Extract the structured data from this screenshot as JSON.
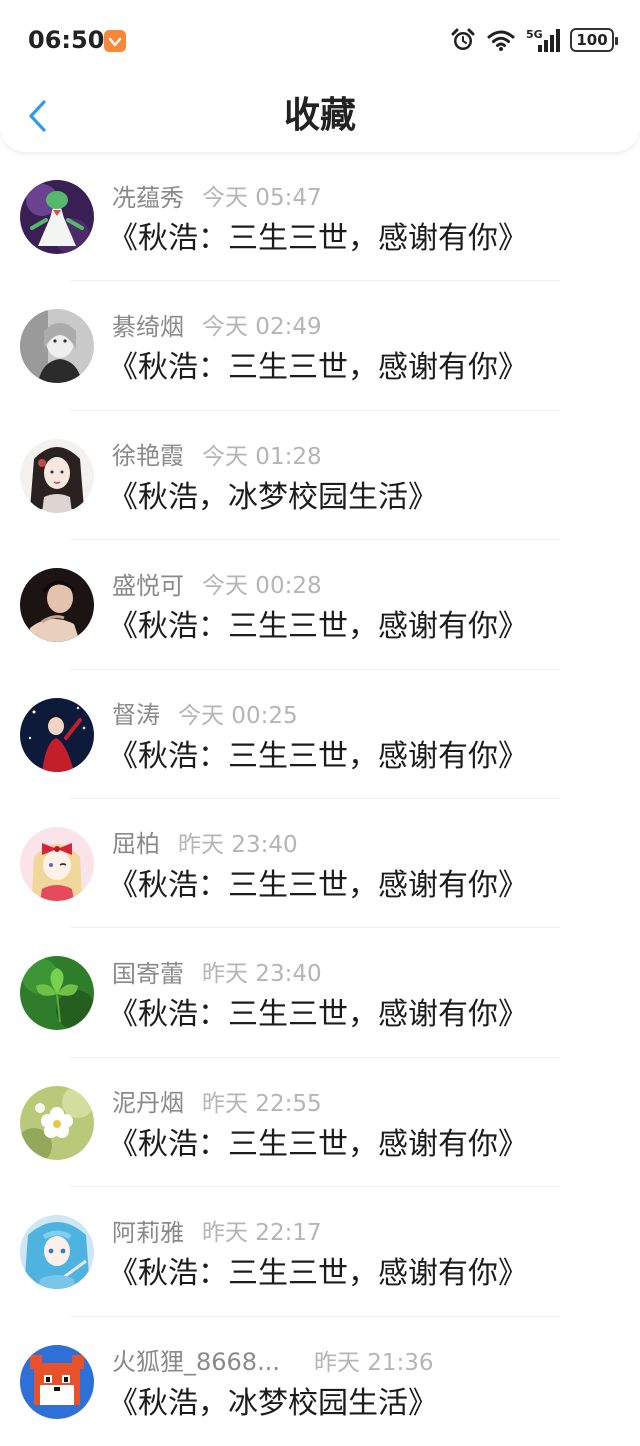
{
  "status_bar": {
    "time": "06:50",
    "network": "5G",
    "battery": "100",
    "app_badge_color": "#f5893a"
  },
  "nav": {
    "back_icon": "chevron-left-icon",
    "title": "收藏",
    "accent": "#2f9bf0"
  },
  "items": [
    {
      "name": "冼蕴秀",
      "time": "今天 05:47",
      "title": "《秋浩：三生三世，感谢有你》",
      "avatar": "pokemon-gardevoir"
    },
    {
      "name": "綦绮烟",
      "time": "今天 02:49",
      "title": "《秋浩：三生三世，感谢有你》",
      "avatar": "bw-girl-portrait"
    },
    {
      "name": "徐艳霞",
      "time": "今天 01:28",
      "title": "《秋浩，冰梦校园生活》",
      "avatar": "ink-girl"
    },
    {
      "name": "盛悦可",
      "time": "今天 00:28",
      "title": "《秋浩：三生三世，感谢有你》",
      "avatar": "dark-portrait"
    },
    {
      "name": "督涛",
      "time": "今天 00:25",
      "title": "《秋浩：三生三世，感谢有你》",
      "avatar": "red-dress-girl"
    },
    {
      "name": "屈柏",
      "time": "昨天 23:40",
      "title": "《秋浩：三生三世，感谢有你》",
      "avatar": "anime-bow-girl"
    },
    {
      "name": "国寄蕾",
      "time": "昨天 23:40",
      "title": "《秋浩：三生三世，感谢有你》",
      "avatar": "green-leaves"
    },
    {
      "name": "泥丹烟",
      "time": "昨天 22:55",
      "title": "《秋浩：三生三世，感谢有你》",
      "avatar": "white-blossom"
    },
    {
      "name": "阿莉雅",
      "time": "昨天 22:17",
      "title": "《秋浩：三生三世，感谢有你》",
      "avatar": "anime-blue-hair"
    },
    {
      "name": "火狐狸_8668...",
      "time": "昨天 21:36",
      "title": "《秋浩，冰梦校园生活》",
      "avatar": "pixel-fox"
    }
  ]
}
